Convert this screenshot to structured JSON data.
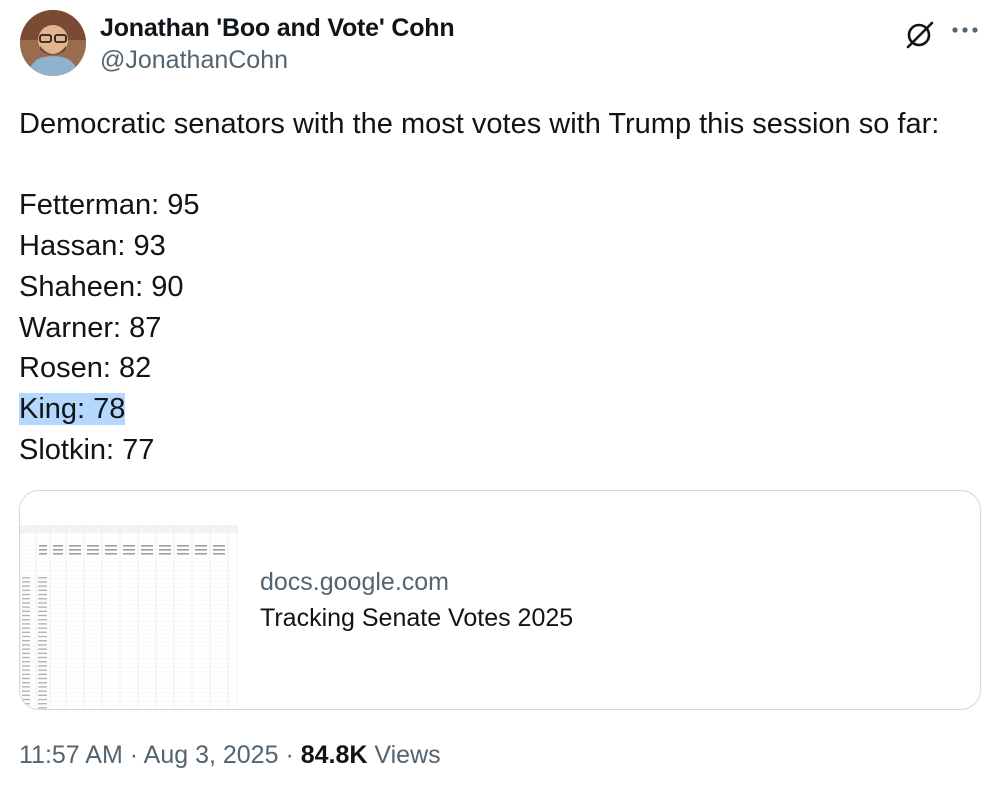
{
  "author": {
    "display_name": "Jonathan 'Boo and Vote' Cohn",
    "handle": "@JonathanCohn",
    "avatar_icon": "user-avatar"
  },
  "header_icons": {
    "grok": "grok-icon",
    "more": "more-icon"
  },
  "tweet": {
    "intro": "Democratic senators with the most votes with Trump this session so far:",
    "lines": [
      "Fetterman: 95",
      "Hassan: 93",
      "Shaheen: 90",
      "Warner: 87",
      "Rosen: 82",
      "King: 78",
      "Slotkin: 77"
    ],
    "highlighted_line": "King: 78"
  },
  "card": {
    "domain": "docs.google.com",
    "title": "Tracking Senate Votes 2025"
  },
  "meta": {
    "time": "11:57 AM",
    "sep1": "·",
    "date": "Aug 3, 2025",
    "sep2": "·",
    "views_count": "84.8K",
    "views_label": "Views"
  },
  "colors": {
    "text": "#0f1419",
    "secondary": "#536471",
    "border": "#cfd9de",
    "highlight": "#b4d7fd"
  }
}
